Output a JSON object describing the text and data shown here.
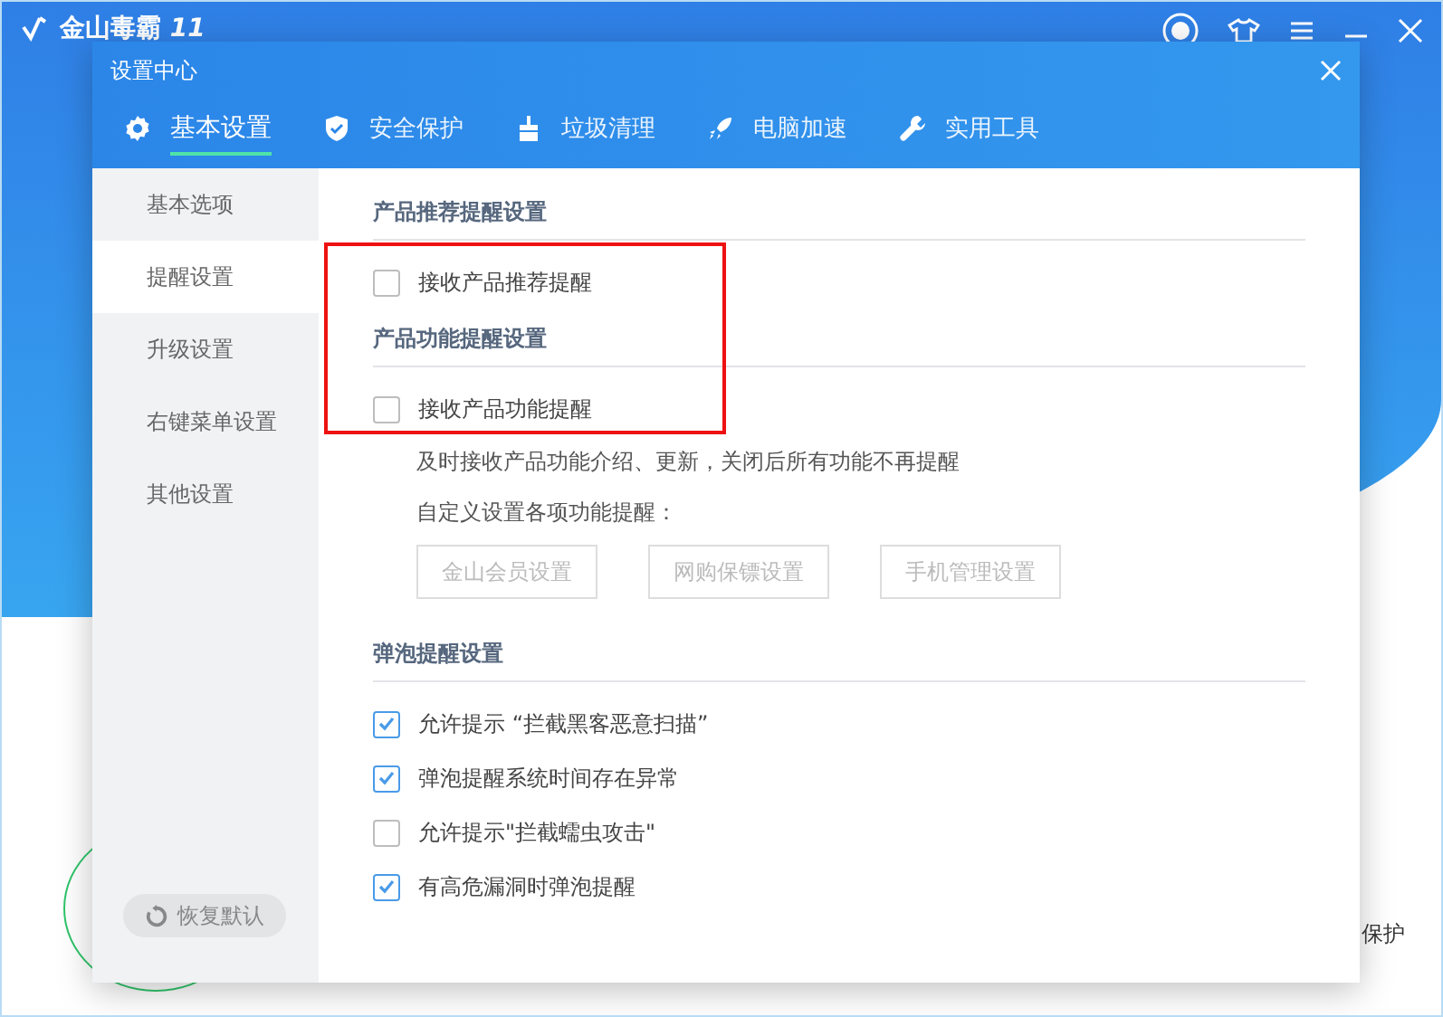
{
  "app": {
    "name": "金山毒霸",
    "version": "11",
    "background_text": "保护"
  },
  "dialog": {
    "title": "设置中心"
  },
  "tabs": [
    {
      "label": "基本设置",
      "kind": "gear",
      "selected": true
    },
    {
      "label": "安全保护",
      "kind": "shield",
      "selected": false
    },
    {
      "label": "垃圾清理",
      "kind": "broom",
      "selected": false
    },
    {
      "label": "电脑加速",
      "kind": "rocket",
      "selected": false
    },
    {
      "label": "实用工具",
      "kind": "wrench",
      "selected": false
    }
  ],
  "sidebar": {
    "items": [
      {
        "label": "基本选项",
        "selected": false
      },
      {
        "label": "提醒设置",
        "selected": true
      },
      {
        "label": "升级设置",
        "selected": false
      },
      {
        "label": "右键菜单设置",
        "selected": false
      },
      {
        "label": "其他设置",
        "selected": false
      }
    ],
    "restore_button": "恢复默认"
  },
  "sections": [
    {
      "heading": "产品推荐提醒设置",
      "items": [
        {
          "kind": "checkbox",
          "label": "接收产品推荐提醒",
          "checked": false
        }
      ]
    },
    {
      "heading": "产品功能提醒设置",
      "items": [
        {
          "kind": "checkbox",
          "label": "接收产品功能提醒",
          "checked": false
        },
        {
          "kind": "note",
          "label": "及时接收产品功能介绍、更新，关闭后所有功能不再提醒"
        },
        {
          "kind": "note",
          "label": "自定义设置各项功能提醒："
        },
        {
          "kind": "buttons",
          "buttons": [
            {
              "label": "金山会员设置",
              "disabled": true
            },
            {
              "label": "网购保镖设置",
              "disabled": true
            },
            {
              "label": "手机管理设置",
              "disabled": true
            }
          ]
        }
      ]
    },
    {
      "heading": "弹泡提醒设置",
      "items": [
        {
          "kind": "checkbox",
          "label": "允许提示 “拦截黑客恶意扫描”",
          "checked": true
        },
        {
          "kind": "checkbox",
          "label": "弹泡提醒系统时间存在异常",
          "checked": true
        },
        {
          "kind": "checkbox",
          "label": "允许提示\"拦截蠕虫攻击\"",
          "checked": false
        },
        {
          "kind": "checkbox",
          "label": "有高危漏洞时弹泡提醒",
          "checked": true
        }
      ]
    }
  ],
  "annotation": {
    "kind": "frame"
  }
}
